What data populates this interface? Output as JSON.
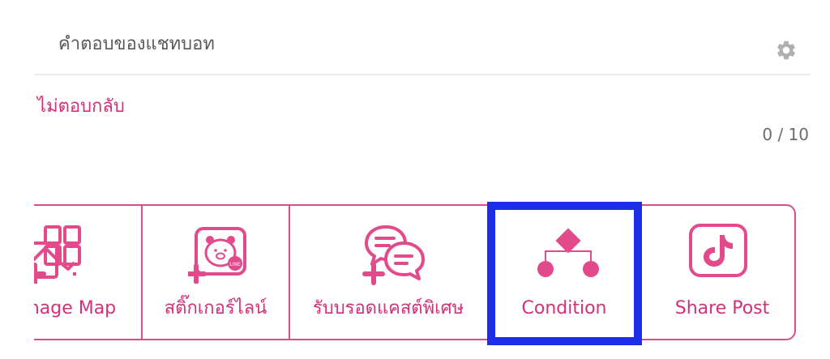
{
  "header": {
    "title": "คำตอบของแชทบอท",
    "settings_icon": "gear-icon"
  },
  "reply": {
    "mode_label": "ไม่ตอบกลับ",
    "counter": "0 / 10"
  },
  "tools": [
    {
      "label": "Image Map",
      "icon": "image-map-icon"
    },
    {
      "label": "สติ๊กเกอร์ไลน์",
      "icon": "line-sticker-icon"
    },
    {
      "label": "รับบรอดแคสต์พิเศษ",
      "icon": "chat-bubbles-add-icon"
    },
    {
      "label": "Condition",
      "icon": "condition-icon",
      "selected": true
    },
    {
      "label": "Share Post",
      "icon": "tiktok-icon"
    }
  ],
  "colors": {
    "accent": "#d4307a",
    "border": "#e24a8c",
    "highlight": "#1c2fe6",
    "text_muted": "#5a5a5a",
    "gear": "#b0b0b0"
  }
}
